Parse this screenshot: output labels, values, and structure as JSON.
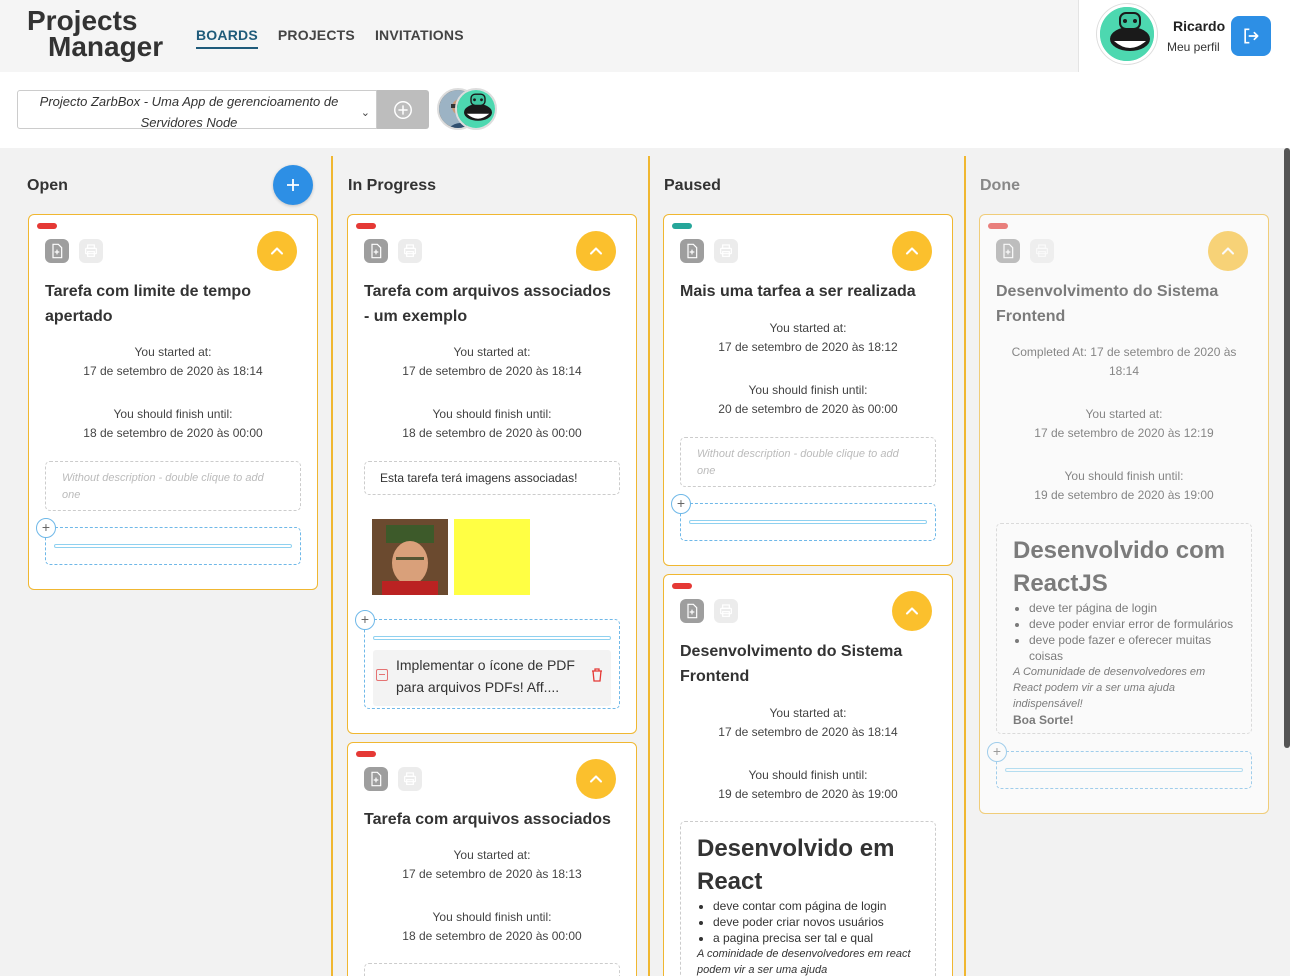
{
  "header": {
    "logo_line1": "Projects",
    "logo_line2": "Manager",
    "nav": [
      "BOARDS",
      "PROJECTS",
      "INVITATIONS"
    ],
    "user_name": "Ricardo",
    "user_profile": "Meu perfil"
  },
  "project": {
    "selected": "Projecto ZarbBox - Uma App de gerencioamento de Servidores Node"
  },
  "columns": {
    "open": "Open",
    "in_progress": "In Progress",
    "paused": "Paused",
    "done": "Done"
  },
  "labels": {
    "started": "You started at:",
    "finish": "You should finish until:",
    "no_desc": "Without description - double clique to add one"
  },
  "colors": {
    "priority_high": "#e53935",
    "priority_low": "#26a69a",
    "accent": "#2d8fe5",
    "expand": "#fbc02d",
    "border": "#f0b731"
  },
  "cards": {
    "open1": {
      "title": "Tarefa com limite de tempo apertado",
      "started": "17 de setembro de 2020 às 18:14",
      "finish": "18 de setembro de 2020 às 00:00"
    },
    "prog1": {
      "title": "Tarefa com arquivos associados - um exemplo",
      "started": "17 de setembro de 2020 às 18:14",
      "finish": "18 de setembro de 2020 às 00:00",
      "description": "Esta tarefa terá imagens associadas!",
      "subtask": "Implementar o ícone de PDF para arquivos PDFs! Aff...."
    },
    "prog2": {
      "title": "Tarefa com arquivos associados",
      "started": "17 de setembro de 2020 às 18:13",
      "finish": "18 de setembro de 2020 às 00:00"
    },
    "paused1": {
      "title": "Mais uma tarfea a ser realizada",
      "started": "17 de setembro de 2020 às 18:12",
      "finish": "20 de setembro de 2020 às 00:00"
    },
    "paused2": {
      "title": "Desenvolvimento do Sistema Frontend",
      "started": "17 de setembro de 2020 às 18:14",
      "finish": "19 de setembro de 2020 às 19:00",
      "rich_heading": "Desenvolvido em React",
      "rich_items": [
        "deve contar com página de login",
        "deve poder criar novos usuários",
        "a pagina precisa ser tal e qual"
      ],
      "rich_italic": "A cominidade de desenvolvedores em react podem vir a ser uma ajuda"
    },
    "done1": {
      "title": "Desenvolvimento do Sistema Frontend",
      "completed": "Completed At: 17 de setembro de 2020 às 18:14",
      "started": "17 de setembro de 2020 às 12:19",
      "finish": "19 de setembro de 2020 às 19:00",
      "rich_heading": "Desenvolvido com ReactJS",
      "rich_items": [
        "deve ter página de login",
        "deve poder enviar error de formulários",
        "deve pode fazer e oferecer muitas coisas"
      ],
      "rich_italic": "A Comunidade de desenvolvedores em React podem vir a ser uma ajuda indispensável!",
      "rich_bold": "Boa Sorte!"
    }
  }
}
